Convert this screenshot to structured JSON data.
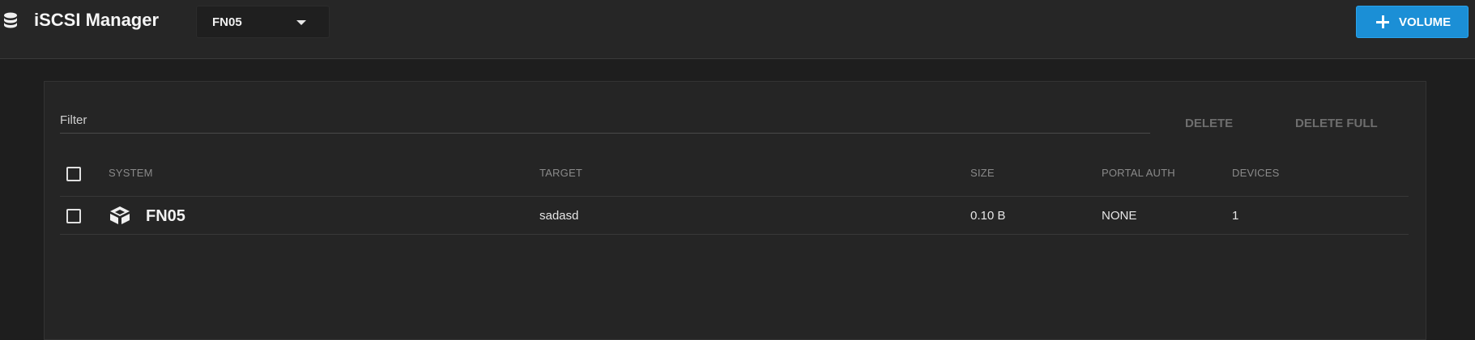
{
  "header": {
    "app_icon": "database-icon",
    "title": "iSCSI Manager",
    "system_select": {
      "value": "FN05"
    },
    "add_volume_button": {
      "label": "VOLUME",
      "icon": "plus-icon",
      "color": "#1b8fd6"
    }
  },
  "toolbar": {
    "filter_label": "Filter",
    "delete_label": "DELETE",
    "delete_full_label": "DELETE FULL"
  },
  "table": {
    "columns": [
      "SYSTEM",
      "TARGET",
      "SIZE",
      "PORTAL AUTH",
      "DEVICES"
    ],
    "rows": [
      {
        "system": "FN05",
        "system_icon": "truenas-logo-icon",
        "target": "sadasd",
        "size": "0.10 B",
        "portal_auth": "NONE",
        "devices": "1"
      }
    ]
  }
}
